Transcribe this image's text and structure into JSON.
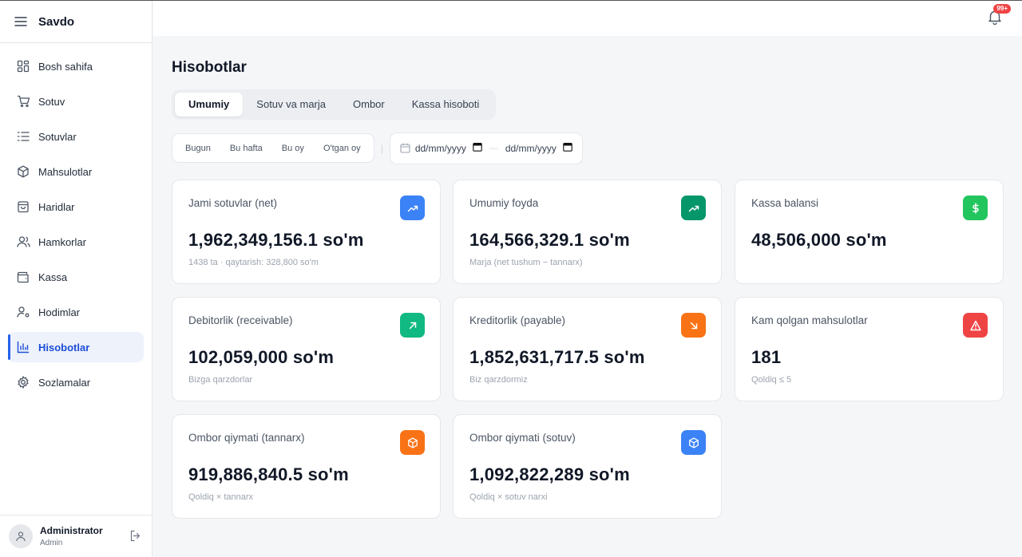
{
  "app": {
    "brand": "Savdo"
  },
  "sidebar": {
    "items": [
      {
        "label": "Bosh sahifa",
        "icon": "grid-icon"
      },
      {
        "label": "Sotuv",
        "icon": "cart-icon"
      },
      {
        "label": "Sotuvlar",
        "icon": "list-icon"
      },
      {
        "label": "Mahsulotlar",
        "icon": "box-icon"
      },
      {
        "label": "Haridlar",
        "icon": "bag-icon"
      },
      {
        "label": "Hamkorlar",
        "icon": "users-icon"
      },
      {
        "label": "Kassa",
        "icon": "wallet-icon"
      },
      {
        "label": "Hodimlar",
        "icon": "user-gear-icon"
      },
      {
        "label": "Hisobotlar",
        "icon": "chart-bars-icon",
        "active": true
      },
      {
        "label": "Sozlamalar",
        "icon": "gear-icon"
      }
    ],
    "user": {
      "name": "Administrator",
      "role": "Admin"
    }
  },
  "topbar": {
    "notifications_badge": "99+"
  },
  "page": {
    "title": "Hisobotlar",
    "tabs": [
      "Umumiy",
      "Sotuv va marja",
      "Ombor",
      "Kassa hisoboti"
    ],
    "active_tab": "Umumiy",
    "ranges": [
      "Bugun",
      "Bu hafta",
      "Bu oy",
      "O'tgan oy"
    ],
    "date_from_placeholder": "dd/mm/yyyy",
    "date_to_placeholder": "dd/mm/yyyy",
    "date_separator": "—",
    "range_separator": "|"
  },
  "cards": [
    {
      "title": "Jami sotuvlar (net)",
      "value": "1,962,349,156.1 so'm",
      "sub": "1438 ta · qaytarish: 328,800 so'm",
      "icon": "trend-up-icon",
      "color": "#3b82f6"
    },
    {
      "title": "Umumiy foyda",
      "value": "164,566,329.1 so'm",
      "sub": "Marja (net tushum − tannarx)",
      "icon": "trend-up-icon",
      "color": "#059669"
    },
    {
      "title": "Kassa balansi",
      "value": "48,506,000 so'm",
      "sub": "",
      "icon": "dollar-icon",
      "color": "#22c55e"
    },
    {
      "title": "Debitorlik (receivable)",
      "value": "102,059,000 so'm",
      "sub": "Bizga qarzdorlar",
      "icon": "arrow-up-right-icon",
      "color": "#10b981"
    },
    {
      "title": "Kreditorlik (payable)",
      "value": "1,852,631,717.5 so'm",
      "sub": "Biz qarzdormiz",
      "icon": "arrow-down-right-icon",
      "color": "#f97316"
    },
    {
      "title": "Kam qolgan mahsulotlar",
      "value": "181",
      "sub": "Qoldiq ≤ 5",
      "icon": "warning-icon",
      "color": "#ef4444"
    },
    {
      "title": "Ombor qiymati (tannarx)",
      "value": "919,886,840.5 so'm",
      "sub": "Qoldiq × tannarx",
      "icon": "box-icon",
      "color": "#f97316"
    },
    {
      "title": "Ombor qiymati (sotuv)",
      "value": "1,092,822,289 so'm",
      "sub": "Qoldiq × sotuv narxi",
      "icon": "box-icon",
      "color": "#3b82f6"
    }
  ]
}
